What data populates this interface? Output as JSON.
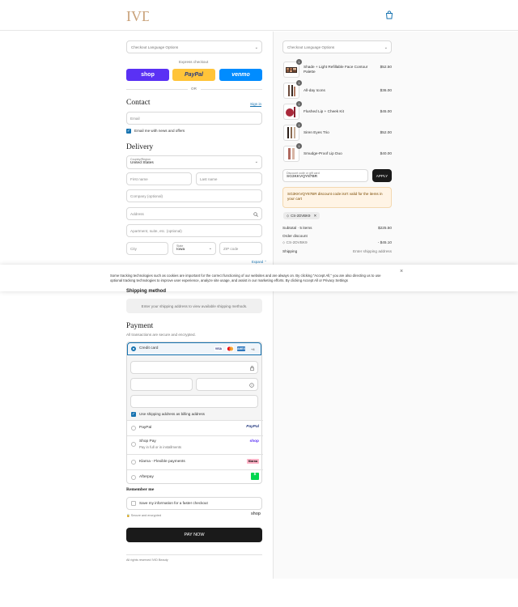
{
  "header": {
    "brand_logo": "IVD",
    "cart_icon": "bag-icon"
  },
  "left": {
    "language_select": "Checkout Language Options",
    "express_checkout": "Express checkout",
    "express_buttons": {
      "shop": "shop",
      "paypal": "PayPal",
      "venmo": "venmo"
    },
    "or": "OR",
    "contact": {
      "title": "Contact",
      "signin": "Sign in",
      "email_placeholder": "Email",
      "newsletter_label": "Email me with news and offers"
    },
    "delivery": {
      "title": "Delivery",
      "country_label": "Country/Region",
      "country_value": "United States",
      "first_name": "First name",
      "last_name": "Last name",
      "company": "Company (optional)",
      "address": "Address",
      "apartment": "Apartment, suite, etc. (optional)",
      "city": "City",
      "state_label": "State",
      "state_value": "Iowa",
      "zip": "ZIP code",
      "expand": "Expand"
    },
    "shipping_method": {
      "title": "Shipping method",
      "note": "Enter your shipping address to view available shipping methods."
    },
    "payment": {
      "title": "Payment",
      "subtitle": "All transactions are secure and encrypted.",
      "credit_card": "Credit card",
      "card_brands": [
        "VISA",
        "MC",
        "AMEX"
      ],
      "more_cards": "+4",
      "billing_same": "Use shipping address as billing address",
      "methods": [
        {
          "label": "PayPal",
          "sub": "",
          "badge": "PayPal"
        },
        {
          "label": "Shop Pay",
          "sub": "Pay in full or in installments",
          "badge": "shop"
        },
        {
          "label": "Klarna - Flexible payments",
          "sub": "",
          "badge": "Klarna"
        },
        {
          "label": "Afterpay",
          "sub": "",
          "badge": "$"
        }
      ]
    },
    "remember": {
      "title": "Remember me",
      "save_label": "Save my information for a faster checkout",
      "secure": "Secure and encrypted",
      "shop_logo": "shop"
    },
    "pay_now": "PAY NOW",
    "footer": "All rights reserved IVID Beauty"
  },
  "cookie": {
    "text": "Some tracking technologies such as cookies are important for the correct functioning of our websites and are always on. By clicking \"Accept All,\" you are also directing us to use optional tracking technologies to improve user experience, analyze site usage, and assist in our marketing efforts. By clicking Accept All or Privacy Settings",
    "close": "×"
  },
  "right": {
    "language_select": "Checkout Language Options",
    "items": [
      {
        "qty": "1",
        "name": "Shade + Light Refillable Face Contour Palette",
        "price": "$52.50"
      },
      {
        "qty": "1",
        "name": "All-day Icons",
        "price": "$36.00"
      },
      {
        "qty": "1",
        "name": "Flushed Lip + Cheek Kit",
        "price": "$45.00"
      },
      {
        "qty": "1",
        "name": "Siren Eyes Trio",
        "price": "$52.00"
      },
      {
        "qty": "1",
        "name": "Smudge-Proof Lip Duo",
        "price": "$40.00"
      }
    ],
    "discount_label": "Discount code or gift card",
    "discount_value": "SG3KKVQY87BR",
    "apply": "APPLY",
    "warning": "SG3KKVQY87BR discount code isn't valid for the items in your cart",
    "applied_code": "CS-2DVBK9",
    "subtotal_label": "Subtotal · 5 items",
    "subtotal_value": "$225.50",
    "order_discount_label": "Order discount",
    "order_discount_code": "CS-2DVBK9",
    "order_discount_value": "- $45.10",
    "shipping_label": "Shipping",
    "shipping_value": "Enter shipping address"
  }
}
